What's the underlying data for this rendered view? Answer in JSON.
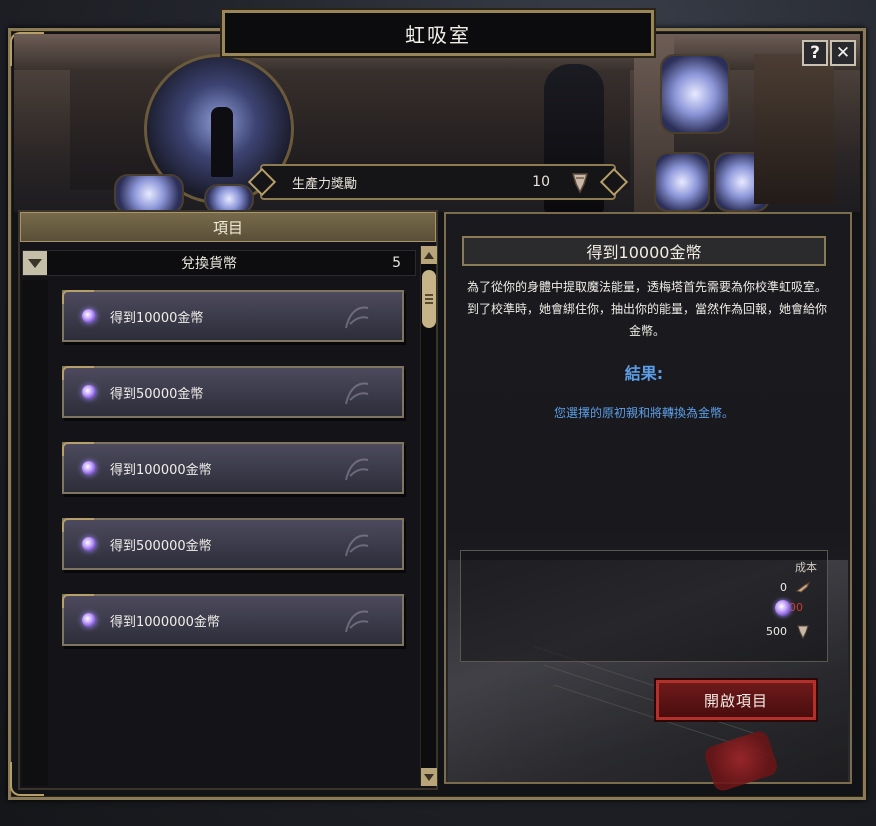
{
  "window": {
    "title": "虹吸室",
    "help_label": "?",
    "close_label": "✕"
  },
  "reward": {
    "label": "生產力獎勵",
    "value": "10"
  },
  "list": {
    "header": "項目",
    "category": {
      "label": "兌換貨幣",
      "count": "5"
    },
    "items": [
      {
        "label": "得到10000金幣"
      },
      {
        "label": "得到50000金幣"
      },
      {
        "label": "得到100000金幣"
      },
      {
        "label": "得到500000金幣"
      },
      {
        "label": "得到1000000金幣"
      }
    ]
  },
  "detail": {
    "title": "得到10000金幣",
    "description": "為了從你的身體中提取魔法能量，透梅塔首先需要為你校準虹吸室。到了校準時，她會綁住你，抽出你的能量，當然作為回報，她會給你金幣。",
    "result_label": "結果:",
    "result_text": "您選擇的原初親和將轉換為金幣。",
    "cost": {
      "title": "成本",
      "rows": [
        {
          "amount": "0",
          "icon": "tool-icon",
          "color": "#efece6"
        },
        {
          "amount": "1000",
          "icon": "affinity-orb-icon",
          "color": "#d03a2c"
        },
        {
          "amount": "500",
          "icon": "productivity-gem-icon",
          "color": "#efece6"
        }
      ]
    },
    "open_button": "開啟項目"
  },
  "colors": {
    "accent_gold": "#8a7a55",
    "result_blue": "#5c9ee6",
    "insufficient_red": "#d03a2c",
    "button_red": "#6e1a1a"
  }
}
